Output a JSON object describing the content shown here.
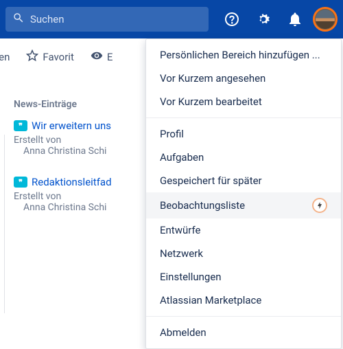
{
  "colors": {
    "brand": "#0747a6",
    "accent_ring": "#f97316",
    "link": "#0052cc",
    "quote_bg": "#00b8d9"
  },
  "topbar": {
    "search_placeholder": "Suchen"
  },
  "toolbar": {
    "edit_label": "arbeiten",
    "favorite_label": "Favorit",
    "watch_label_partial": "E"
  },
  "content": {
    "news_heading": "News-Einträge",
    "items": [
      {
        "title": "Wir erweitern uns",
        "created_by_label": "Erstellt von",
        "author": "Anna Christina Schi"
      },
      {
        "title": "Redaktionsleitfad",
        "created_by_label": "Erstellt von",
        "author": "Anna Christina Schi"
      }
    ]
  },
  "dropdown": {
    "groups": [
      [
        "Persönlichen Bereich hinzufügen ...",
        "Vor Kurzem angesehen",
        "Vor Kurzem bearbeitet"
      ],
      [
        "Profil",
        "Aufgaben",
        "Gespeichert für später",
        "Beobachtungsliste",
        "Entwürfe",
        "Netzwerk",
        "Einstellungen",
        "Atlassian Marketplace"
      ],
      [
        "Abmelden"
      ]
    ],
    "highlighted": "Beobachtungsliste"
  }
}
